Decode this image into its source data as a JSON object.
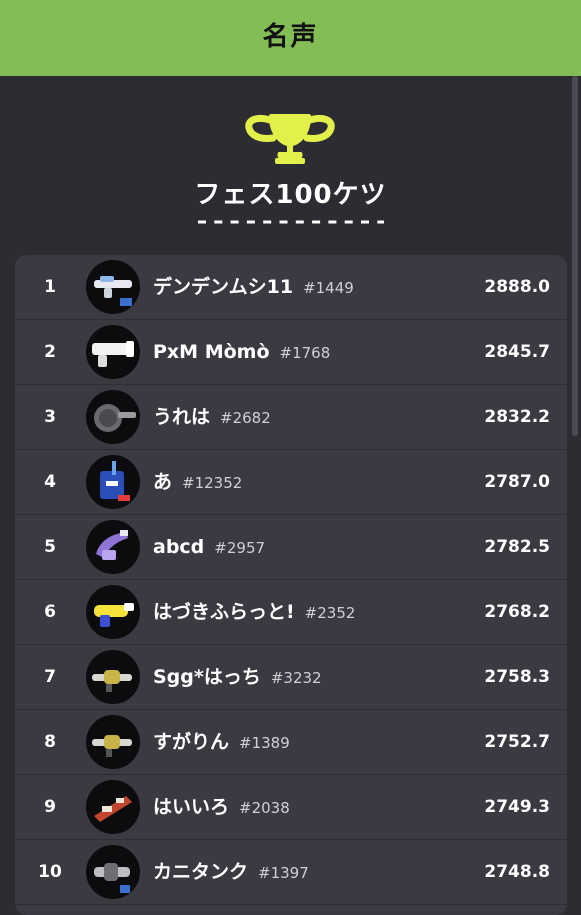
{
  "header": {
    "title": "名声"
  },
  "festival": {
    "title": "フェス100ケツ"
  },
  "colors": {
    "header_bg": "#82bd55",
    "trophy": "#e4f04a",
    "page_bg": "#2c2c33",
    "board_bg": "#3a3a43"
  },
  "rankings": [
    {
      "rank": "1",
      "name": "デンデンムシ11",
      "tag": "#1449",
      "score": "2888.0",
      "weapon_icon": "splat-charger-icon"
    },
    {
      "rank": "2",
      "name": "PxM Mòmò",
      "tag": "#1768",
      "score": "2845.7",
      "weapon_icon": "splattershot-icon"
    },
    {
      "rank": "3",
      "name": "うれは",
      "tag": "#2682",
      "score": "2832.2",
      "weapon_icon": "frying-pan-icon"
    },
    {
      "rank": "4",
      "name": "あ",
      "tag": "#12352",
      "score": "2787.0",
      "weapon_icon": "bucket-icon"
    },
    {
      "rank": "5",
      "name": "abcd",
      "tag": "#2957",
      "score": "2782.5",
      "weapon_icon": "hydra-splatling-icon"
    },
    {
      "rank": "6",
      "name": "はづきふらっと!",
      "tag": "#2352",
      "score": "2768.2",
      "weapon_icon": "aerospray-icon"
    },
    {
      "rank": "7",
      "name": "Sgg*はっち",
      "tag": "#3232",
      "score": "2758.3",
      "weapon_icon": "squiffer-icon"
    },
    {
      "rank": "8",
      "name": "すがりん",
      "tag": "#1389",
      "score": "2752.7",
      "weapon_icon": "squiffer-icon"
    },
    {
      "rank": "9",
      "name": "はいいろ",
      "tag": "#2038",
      "score": "2749.3",
      "weapon_icon": "blaster-icon"
    },
    {
      "rank": "10",
      "name": "カニタンク",
      "tag": "#1397",
      "score": "2748.8",
      "weapon_icon": "splatling-icon"
    }
  ]
}
